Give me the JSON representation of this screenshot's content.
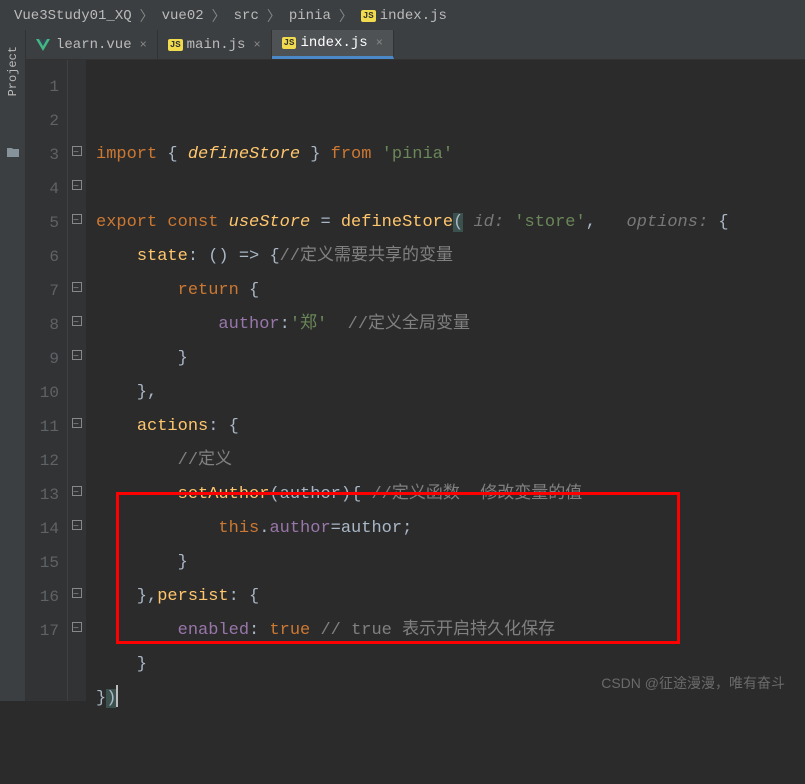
{
  "breadcrumb": {
    "items": [
      "Vue3Study01_XQ",
      "vue02",
      "src",
      "pinia",
      "index.js"
    ]
  },
  "sidebar": {
    "project_label": "Project"
  },
  "tabs": [
    {
      "label": "learn.vue",
      "icon": "vue",
      "active": false
    },
    {
      "label": "main.js",
      "icon": "js",
      "active": false
    },
    {
      "label": "index.js",
      "icon": "js",
      "active": true
    }
  ],
  "code": {
    "lines": [
      {
        "n": 1,
        "tokens": [
          {
            "t": "import ",
            "c": "kw"
          },
          {
            "t": "{ ",
            "c": ""
          },
          {
            "t": "defineStore",
            "c": "fn-italic"
          },
          {
            "t": " } ",
            "c": ""
          },
          {
            "t": "from ",
            "c": "kw"
          },
          {
            "t": "'pinia'",
            "c": "str"
          }
        ]
      },
      {
        "n": 2,
        "tokens": []
      },
      {
        "n": 3,
        "tokens": [
          {
            "t": "export const ",
            "c": "kw"
          },
          {
            "t": "useStore",
            "c": "fn-italic"
          },
          {
            "t": " = ",
            "c": ""
          },
          {
            "t": "defineStore",
            "c": "fn"
          },
          {
            "t": "(",
            "c": "bracket-hl"
          },
          {
            "t": " id: ",
            "c": "hint"
          },
          {
            "t": "'store'",
            "c": "str"
          },
          {
            "t": ", ",
            "c": ""
          },
          {
            "t": "  options: ",
            "c": "hint"
          },
          {
            "t": "{",
            "c": ""
          }
        ]
      },
      {
        "n": 4,
        "tokens": [
          {
            "t": "    ",
            "c": ""
          },
          {
            "t": "state",
            "c": "fn"
          },
          {
            "t": ": () => {",
            "c": ""
          },
          {
            "t": "//定义需要共享的变量",
            "c": "comment"
          }
        ]
      },
      {
        "n": 5,
        "tokens": [
          {
            "t": "        ",
            "c": ""
          },
          {
            "t": "return ",
            "c": "kw"
          },
          {
            "t": "{",
            "c": ""
          }
        ]
      },
      {
        "n": 6,
        "tokens": [
          {
            "t": "            ",
            "c": ""
          },
          {
            "t": "author",
            "c": "prop"
          },
          {
            "t": ":",
            "c": ""
          },
          {
            "t": "'郑'  ",
            "c": "str"
          },
          {
            "t": "//定义全局变量",
            "c": "comment"
          }
        ]
      },
      {
        "n": 7,
        "tokens": [
          {
            "t": "        }",
            "c": ""
          }
        ]
      },
      {
        "n": 8,
        "tokens": [
          {
            "t": "    },",
            "c": ""
          }
        ]
      },
      {
        "n": 9,
        "tokens": [
          {
            "t": "    ",
            "c": ""
          },
          {
            "t": "actions",
            "c": "fn"
          },
          {
            "t": ": {",
            "c": ""
          }
        ]
      },
      {
        "n": 10,
        "tokens": [
          {
            "t": "        ",
            "c": ""
          },
          {
            "t": "//定义",
            "c": "comment"
          }
        ]
      },
      {
        "n": 11,
        "tokens": [
          {
            "t": "        ",
            "c": ""
          },
          {
            "t": "setAuthor",
            "c": "fn"
          },
          {
            "t": "(",
            "c": ""
          },
          {
            "t": "author",
            "c": "param"
          },
          {
            "t": "){ ",
            "c": ""
          },
          {
            "t": "//定义函数  修改变量的值",
            "c": "comment"
          }
        ]
      },
      {
        "n": 12,
        "tokens": [
          {
            "t": "            ",
            "c": ""
          },
          {
            "t": "this",
            "c": "this"
          },
          {
            "t": ".",
            "c": ""
          },
          {
            "t": "author",
            "c": "prop"
          },
          {
            "t": "=",
            "c": ""
          },
          {
            "t": "author",
            "c": "param"
          },
          {
            "t": ";",
            "c": ""
          }
        ]
      },
      {
        "n": 13,
        "tokens": [
          {
            "t": "        }",
            "c": ""
          }
        ]
      },
      {
        "n": 14,
        "tokens": [
          {
            "t": "    },",
            "c": ""
          },
          {
            "t": "persist",
            "c": "fn"
          },
          {
            "t": ": {",
            "c": ""
          }
        ]
      },
      {
        "n": 15,
        "tokens": [
          {
            "t": "        ",
            "c": ""
          },
          {
            "t": "enabled",
            "c": "prop"
          },
          {
            "t": ": ",
            "c": ""
          },
          {
            "t": "true ",
            "c": "kw"
          },
          {
            "t": "// true 表示开启持久化保存",
            "c": "comment"
          }
        ]
      },
      {
        "n": 16,
        "tokens": [
          {
            "t": "    }",
            "c": ""
          }
        ]
      },
      {
        "n": 17,
        "tokens": [
          {
            "t": "}",
            "c": ""
          },
          {
            "t": ")",
            "c": "bracket-hl"
          }
        ]
      }
    ]
  },
  "watermark": "CSDN @征途漫漫，唯有奋斗"
}
